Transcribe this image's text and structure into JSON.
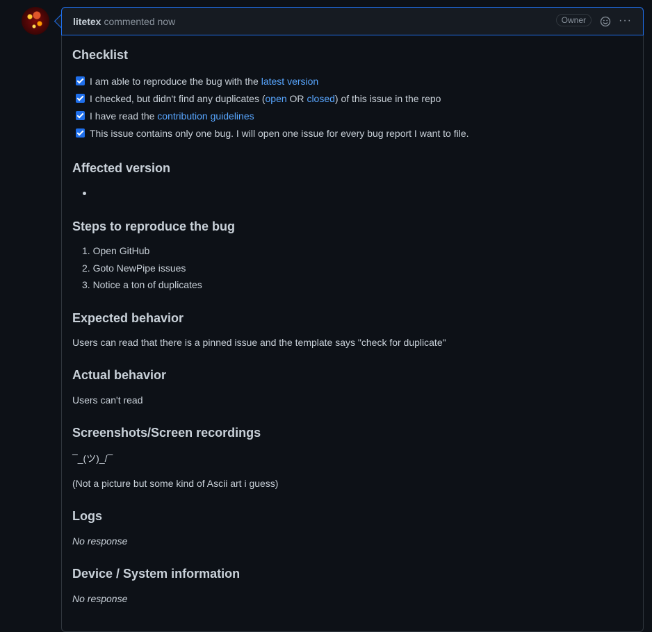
{
  "header": {
    "author": "litetex",
    "meta": "commented now",
    "badge": "Owner",
    "more": "···"
  },
  "checklist": {
    "title": "Checklist",
    "items": [
      {
        "pre": "I am able to reproduce the bug with the ",
        "link": "latest version",
        "post": ""
      },
      {
        "pre": "I checked, but didn't find any duplicates (",
        "link": "open",
        "mid": " OR ",
        "link2": "closed",
        "post": ") of this issue in the repo"
      },
      {
        "pre": "I have read the ",
        "link": "contribution guidelines",
        "post": ""
      },
      {
        "pre": "This issue contains only one bug. I will open one issue for every bug report I want to file.",
        "link": "",
        "post": ""
      }
    ]
  },
  "affected": {
    "title": "Affected version"
  },
  "steps": {
    "title": "Steps to reproduce the bug",
    "items": [
      "1. Open GitHub",
      "2. Goto NewPipe issues",
      "3. Notice a ton of duplicates"
    ]
  },
  "expected": {
    "title": "Expected behavior",
    "text": "Users can read that there is a pinned issue and the template says \"check for duplicate\""
  },
  "actual": {
    "title": "Actual behavior",
    "text": "Users can't read"
  },
  "screens": {
    "title": "Screenshots/Screen recordings",
    "ascii": "¯_(ツ)_/¯",
    "text": "(Not a picture but some kind of Ascii art i guess)"
  },
  "logs": {
    "title": "Logs",
    "text": "No response"
  },
  "device": {
    "title": "Device / System information",
    "text": "No response"
  }
}
